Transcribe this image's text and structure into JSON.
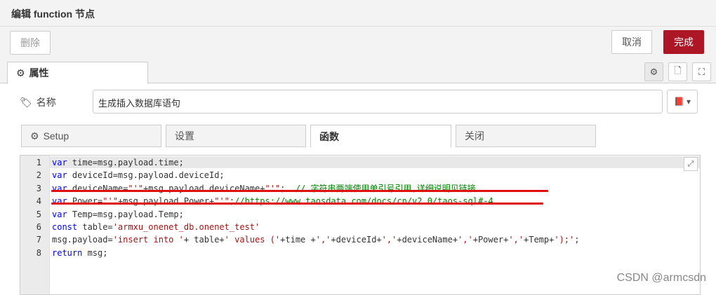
{
  "window": {
    "title": "编辑 function 节点"
  },
  "toolbar": {
    "delete_label": "删除",
    "cancel_label": "取消",
    "done_label": "完成"
  },
  "tabs": {
    "properties_label": "属性"
  },
  "form": {
    "name_label": "名称",
    "name_value": "生成插入数据库语句"
  },
  "subtabs": [
    "Setup",
    "设置",
    "函数",
    "关闭"
  ],
  "editor": {
    "line_numbers": [
      "1",
      "2",
      "3",
      "4",
      "5",
      "6",
      "7",
      "8"
    ],
    "lines": [
      [
        {
          "t": "kw",
          "v": "var"
        },
        {
          "t": "",
          "v": " time=msg.payload.time;"
        }
      ],
      [
        {
          "t": "kw",
          "v": "var"
        },
        {
          "t": "",
          "v": " deviceId=msg.payload.deviceId;"
        }
      ],
      [
        {
          "t": "kw",
          "v": "var"
        },
        {
          "t": "",
          "v": " deviceName="
        },
        {
          "t": "str",
          "v": "\"'\""
        },
        {
          "t": "",
          "v": "+msg.payload.deviceName+"
        },
        {
          "t": "str",
          "v": "\"'\""
        },
        {
          "t": "",
          "v": ";  "
        },
        {
          "t": "cm",
          "v": "// 字符串两端使用单引号引用,详细说明见链接"
        }
      ],
      [
        {
          "t": "kw",
          "v": "var"
        },
        {
          "t": "",
          "v": " Power="
        },
        {
          "t": "str",
          "v": "\"'\""
        },
        {
          "t": "",
          "v": "+msg.payload.Power+"
        },
        {
          "t": "str",
          "v": "\"'\""
        },
        {
          "t": "",
          "v": ";"
        },
        {
          "t": "cm",
          "v": "//https://www.taosdata.com/docs/cn/v2.0/taos-sql#-4"
        }
      ],
      [
        {
          "t": "kw",
          "v": "var"
        },
        {
          "t": "",
          "v": " Temp=msg.payload.Temp;"
        }
      ],
      [
        {
          "t": "kw",
          "v": "const"
        },
        {
          "t": "",
          "v": " table="
        },
        {
          "t": "str",
          "v": "'armxu_onenet_db.onenet_test'"
        }
      ],
      [
        {
          "t": "",
          "v": "msg.payload="
        },
        {
          "t": "str",
          "v": "'insert into '"
        },
        {
          "t": "",
          "v": "+ table+"
        },
        {
          "t": "str",
          "v": "' values ('"
        },
        {
          "t": "",
          "v": "+time +"
        },
        {
          "t": "str",
          "v": "','"
        },
        {
          "t": "",
          "v": "+deviceId+"
        },
        {
          "t": "str",
          "v": "','"
        },
        {
          "t": "",
          "v": "+deviceName+"
        },
        {
          "t": "str",
          "v": "','"
        },
        {
          "t": "",
          "v": "+Power+"
        },
        {
          "t": "str",
          "v": "','"
        },
        {
          "t": "",
          "v": "+Temp+"
        },
        {
          "t": "str",
          "v": "');'"
        },
        {
          "t": "",
          "v": ";"
        }
      ],
      [
        {
          "t": "kw",
          "v": "return"
        },
        {
          "t": "",
          "v": " msg;"
        }
      ]
    ]
  },
  "watermark": "CSDN @armcsdn",
  "colors": {
    "done_button": "#ad1625",
    "keyword": "#0000ff",
    "string": "#a31515",
    "comment": "#008000",
    "annotation": "#e01010"
  }
}
